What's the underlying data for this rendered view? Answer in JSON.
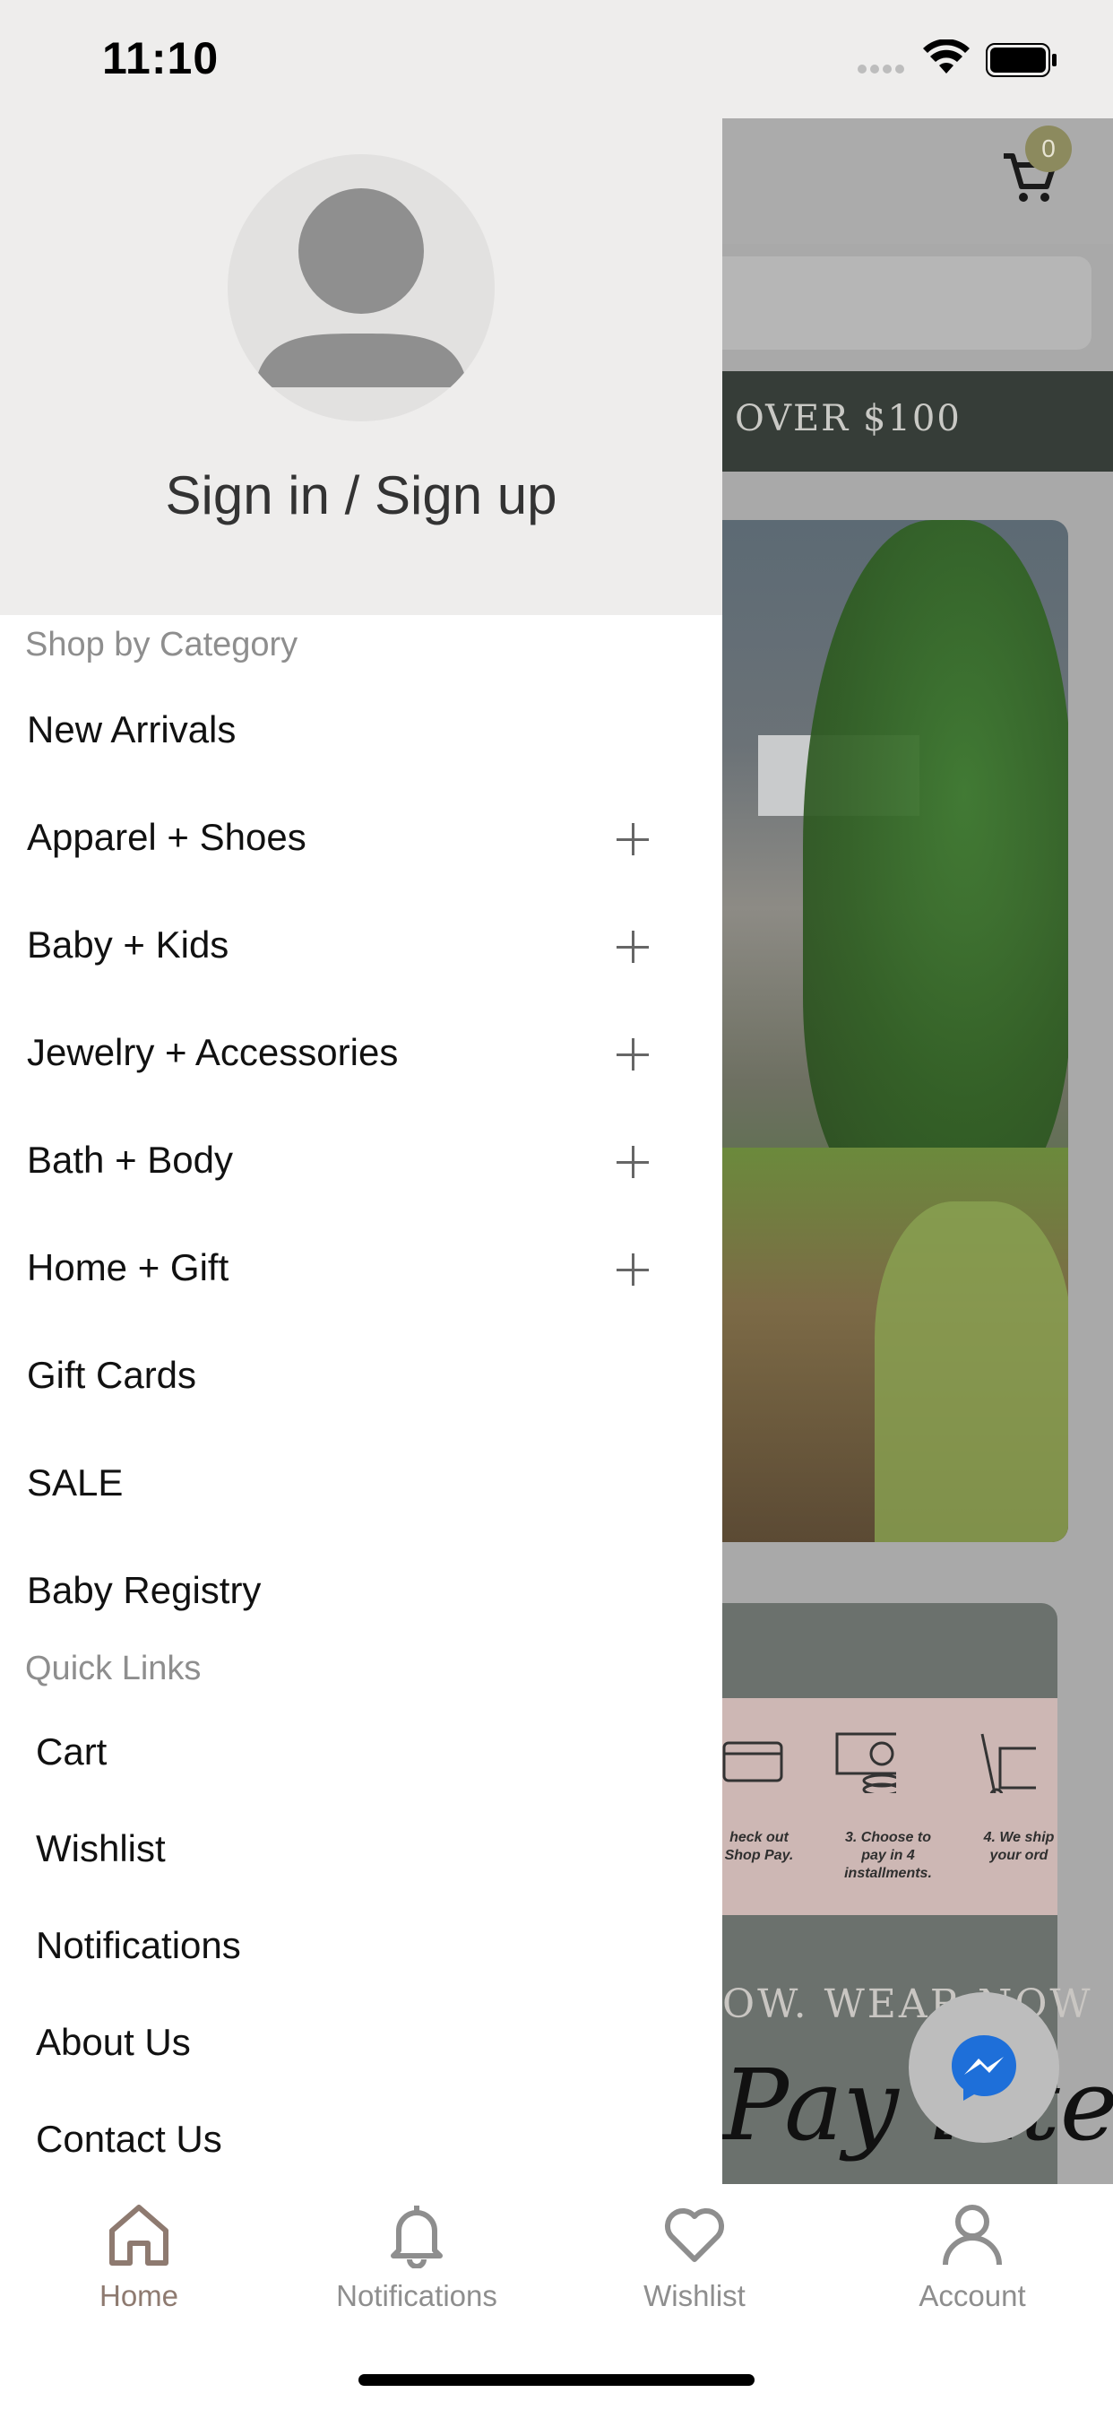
{
  "status_bar": {
    "time": "11:10"
  },
  "background_app": {
    "cart_count": "0",
    "banner_text": "OVER $100",
    "steps": [
      "heck out\nShop Pay.",
      "3. Choose to\npay in 4\ninstallments.",
      "4. We ship\nyour ord"
    ],
    "promo_line": "OW. WEAR NOW",
    "script_text": "Pay later"
  },
  "drawer": {
    "sign_in_label": "Sign in / Sign up",
    "category_section_title": "Shop by Category",
    "categories": [
      {
        "label": "New Arrivals",
        "expandable": false
      },
      {
        "label": "Apparel + Shoes",
        "expandable": true
      },
      {
        "label": "Baby + Kids",
        "expandable": true
      },
      {
        "label": "Jewelry + Accessories",
        "expandable": true
      },
      {
        "label": "Bath + Body",
        "expandable": true
      },
      {
        "label": "Home + Gift",
        "expandable": true
      },
      {
        "label": "Gift Cards",
        "expandable": false
      },
      {
        "label": "SALE",
        "expandable": false
      },
      {
        "label": "Baby Registry",
        "expandable": false
      }
    ],
    "quick_links_title": "Quick Links",
    "quick_links": [
      "Cart",
      "Wishlist",
      "Notifications",
      "About Us",
      "Contact Us"
    ]
  },
  "tab_bar": {
    "tabs": [
      {
        "label": "Home",
        "icon": "home-icon",
        "active": true
      },
      {
        "label": "Notifications",
        "icon": "bell-icon",
        "active": false
      },
      {
        "label": "Wishlist",
        "icon": "heart-icon",
        "active": false
      },
      {
        "label": "Account",
        "icon": "person-icon",
        "active": false
      }
    ]
  },
  "colors": {
    "drawer_header_bg": "#EEEDEC",
    "active_tab": "#8E7A70",
    "inactive_tab": "#8E8E8E",
    "section_title": "#8E8E8E"
  }
}
